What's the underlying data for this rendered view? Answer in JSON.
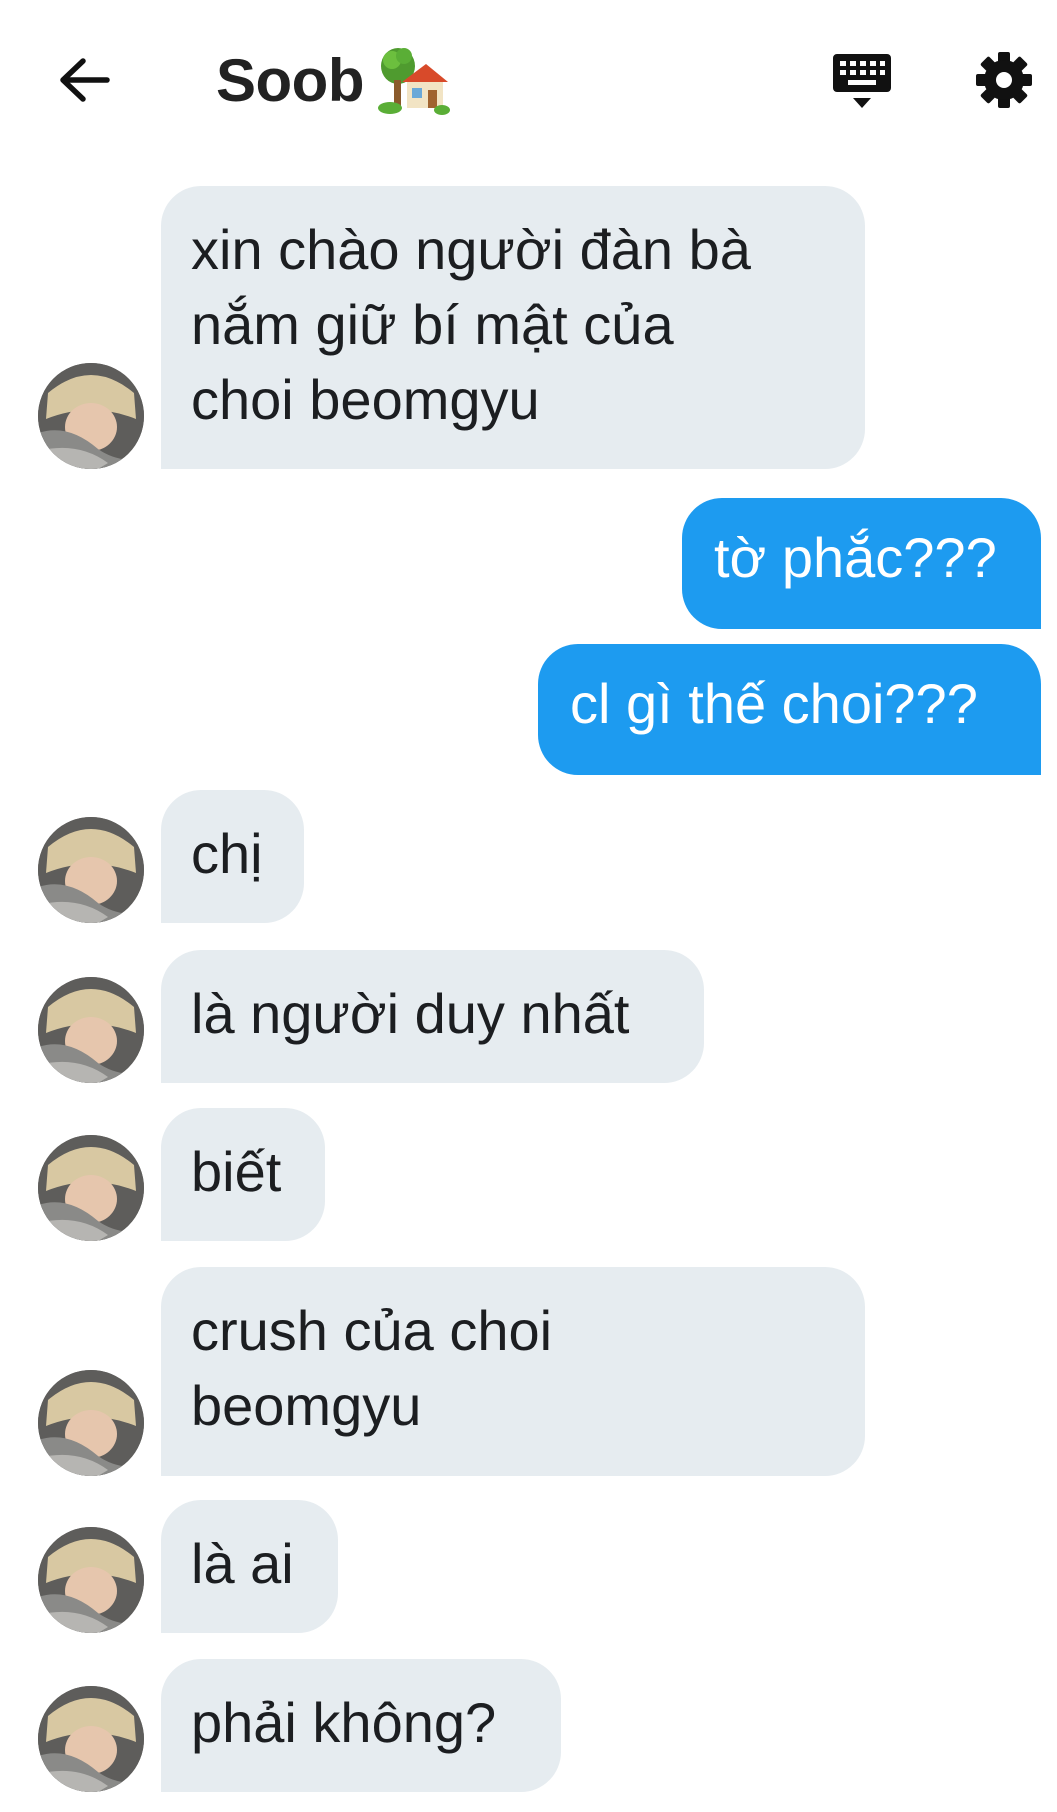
{
  "header": {
    "title": "Soob",
    "title_emoji_icon": "house-with-garden-icon",
    "back_icon": "arrow-left-icon",
    "keyboard_icon": "keyboard-icon",
    "settings_icon": "gear-icon"
  },
  "colors": {
    "incoming_bubble": "#e6ecf0",
    "outgoing_bubble": "#1d9bf0",
    "text_dark": "#1c1e21",
    "text_light": "#ffffff"
  },
  "messages": [
    {
      "sender": "them",
      "text": "xin chào người đàn bà\nnắm giữ bí mật của\nchoi beomgyu"
    },
    {
      "sender": "me",
      "text": "tờ phắc???"
    },
    {
      "sender": "me",
      "text": "cl gì thế choi???"
    },
    {
      "sender": "them",
      "text": "chị"
    },
    {
      "sender": "them",
      "text": "là người duy nhất"
    },
    {
      "sender": "them",
      "text": "biết"
    },
    {
      "sender": "them",
      "text": "crush của choi\nbeomgyu"
    },
    {
      "sender": "them",
      "text": "là ai"
    },
    {
      "sender": "them",
      "text": "phải không?"
    }
  ]
}
